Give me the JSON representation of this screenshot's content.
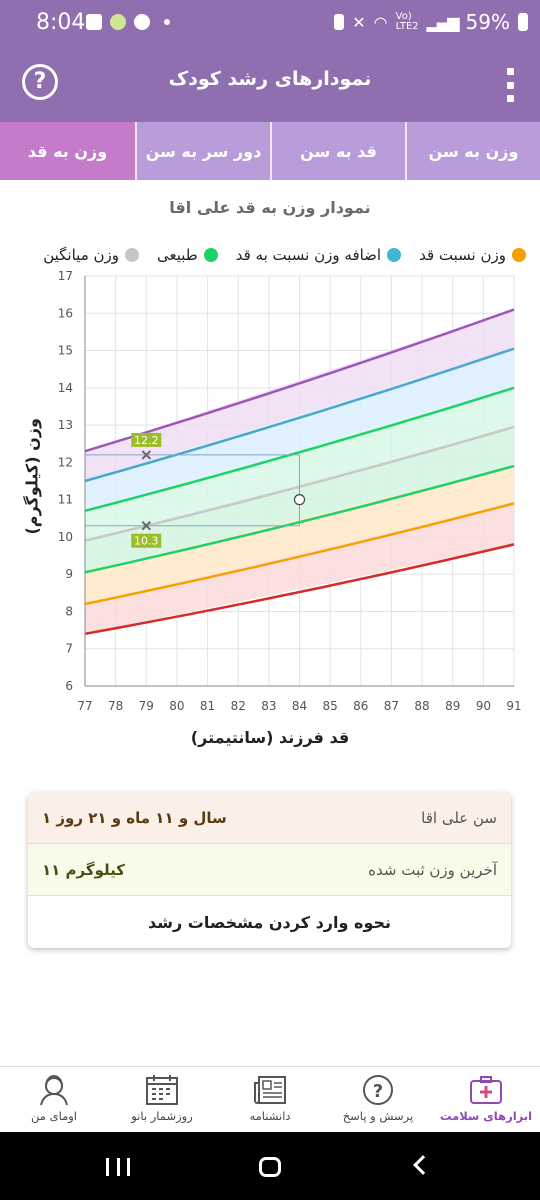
{
  "status_bar": {
    "time": "8:04",
    "battery": "59%",
    "volte": "Vo)",
    "lte": "LTE2"
  },
  "toolbar": {
    "title": "نمودارهای رشد کودک",
    "help_symbol": "?",
    "help_icon": "help-circle-icon",
    "menu_icon": "kebab-menu-icon"
  },
  "tabs": [
    {
      "label": "وزن به سن",
      "active": false
    },
    {
      "label": "قد به سن",
      "active": false
    },
    {
      "label": "دور سر به سن",
      "active": false
    },
    {
      "label": "وزن به قد",
      "active": true
    }
  ],
  "chart_title": "نمودار وزن به قد علی اقا",
  "legend": [
    {
      "label": "وزن نسبت قد",
      "color": "#f5a200"
    },
    {
      "label": "اضافه وزن نسبت به قد",
      "color": "#3fb5cf"
    },
    {
      "label": "طبیعی",
      "color": "#1ed26a"
    },
    {
      "label": "وزن میانگین",
      "color": "#c6c6c6"
    }
  ],
  "chart_data": {
    "type": "area",
    "xlabel": "قد فرزند (سانتیمتر)",
    "ylabel": "وزن (کیلوگرم)",
    "xlim": [
      77,
      91
    ],
    "ylim": [
      6,
      17
    ],
    "x_ticks": [
      77,
      78,
      79,
      80,
      81,
      82,
      83,
      84,
      85,
      86,
      87,
      88,
      89,
      90,
      91
    ],
    "y_ticks": [
      6,
      7,
      8,
      9,
      10,
      11,
      12,
      13,
      14,
      15,
      16,
      17
    ],
    "grid": true,
    "x": [
      77,
      91
    ],
    "series": [
      {
        "color": "#d62b2b",
        "values": [
          7.4,
          9.8
        ]
      },
      {
        "color": "#f5a200",
        "values": [
          8.2,
          10.9
        ]
      },
      {
        "color": "#1ed26a",
        "values": [
          9.05,
          11.9
        ]
      },
      {
        "color": "#c8c8c8",
        "values": [
          9.9,
          12.95
        ]
      },
      {
        "color": "#1ed26a",
        "values": [
          10.7,
          14.0
        ]
      },
      {
        "color": "#4aa8c8",
        "values": [
          11.5,
          15.05
        ]
      },
      {
        "color": "#9b59b6",
        "values": [
          12.3,
          16.1
        ]
      }
    ],
    "band_fills": [
      "#fbd9d9",
      "#ffe9c8",
      "#d2f5e0",
      "#d8f7e6",
      "#dcefff",
      "#eeddf5"
    ],
    "markers": [
      {
        "x": 79,
        "y": 12.2,
        "label": "12.2",
        "shape": "x"
      },
      {
        "x": 79,
        "y": 10.3,
        "label": "10.3",
        "shape": "x"
      }
    ],
    "crosshair_point": {
      "x": 84,
      "y": 11
    }
  },
  "info_card": {
    "age_label": "سن علی اقا",
    "age_value": "۱ سال و ۱۱ ماه و ۲۱ روز",
    "weight_label": "آخرین وزن ثبت شده",
    "weight_value": "۱۱ کیلوگرم",
    "guide_link": "نحوه وارد کردن مشخصات رشد"
  },
  "bottom_nav": [
    {
      "label": "ابزارهای سلامت",
      "icon": "medical-kit-icon",
      "active": true
    },
    {
      "label": "پرسش و پاسخ",
      "icon": "question-bubble-icon",
      "active": false
    },
    {
      "label": "دانشنامه",
      "icon": "newspaper-icon",
      "active": false
    },
    {
      "label": "روزشمار بانو",
      "icon": "calendar-icon",
      "active": false
    },
    {
      "label": "اومای من",
      "icon": "profile-icon",
      "active": false
    }
  ]
}
